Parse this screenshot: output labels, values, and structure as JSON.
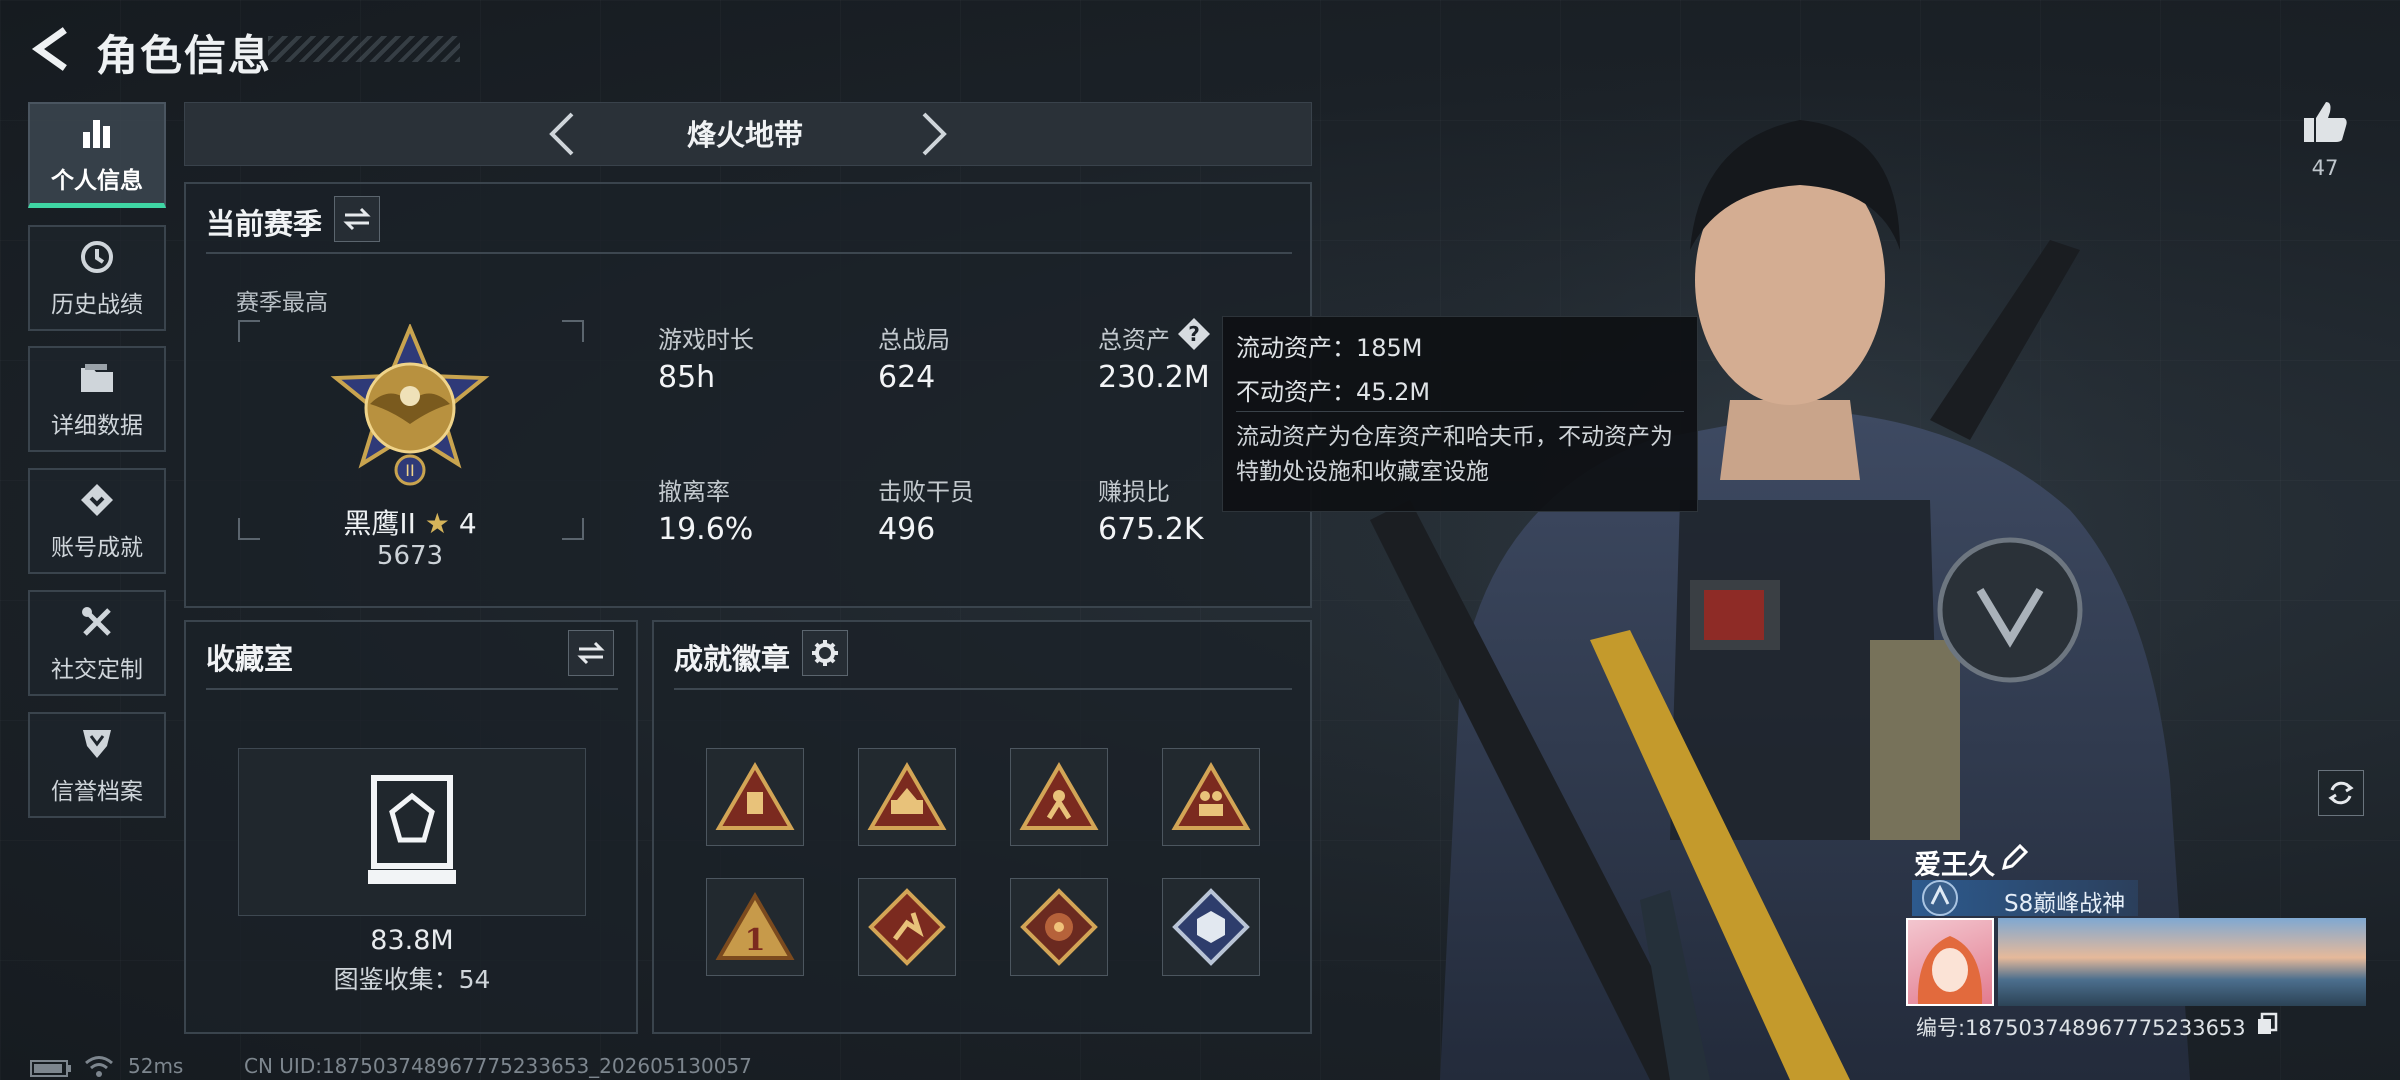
{
  "header": {
    "title": "角色信息"
  },
  "nav": {
    "items": [
      {
        "label": "个人信息",
        "icon": "bar-chart-icon"
      },
      {
        "label": "历史战绩",
        "icon": "history-clock-icon"
      },
      {
        "label": "详细数据",
        "icon": "folder-icon"
      },
      {
        "label": "账号成就",
        "icon": "achievement-icon"
      },
      {
        "label": "社交定制",
        "icon": "tools-icon"
      },
      {
        "label": "信誉档案",
        "icon": "emblem-icon"
      }
    ]
  },
  "mode": {
    "name": "烽火地带"
  },
  "season": {
    "title": "当前赛季",
    "best_label": "赛季最高",
    "rank_name": "黑鹰II",
    "rank_stars": "4",
    "rank_score": "5673",
    "stats": [
      {
        "label": "游戏时长",
        "value": "85h"
      },
      {
        "label": "总战局",
        "value": "624"
      },
      {
        "label": "总资产",
        "value": "230.2M"
      },
      {
        "label": "撤离率",
        "value": "19.6%"
      },
      {
        "label": "击败干员",
        "value": "496"
      },
      {
        "label": "赚损比",
        "value": "675.2K"
      }
    ]
  },
  "tooltip": {
    "liquid": "流动资产：185M",
    "fixed": "不动资产：45.2M",
    "desc": "流动资产为仓库资产和哈夫币，不动资产为特勤处设施和收藏室设施"
  },
  "collection": {
    "title": "收藏室",
    "value": "83.8M",
    "count_text": "图鉴收集：54"
  },
  "badges": {
    "title": "成就徽章",
    "items": [
      "bag",
      "camp",
      "fighter",
      "squad",
      "first",
      "runner",
      "dragon",
      "cube"
    ]
  },
  "like": {
    "count": "47"
  },
  "player": {
    "name": "爱王久",
    "title": "S8巅峰战神",
    "uid": "编号:1875037489677752336​53"
  },
  "status": {
    "ping": "52ms",
    "uid": "CN UID:187503748967775233653_202605130057"
  },
  "colors": {
    "accent": "#3fd6a4",
    "badge_gold": "#c79a4a",
    "badge_red": "#7b2a1f"
  }
}
